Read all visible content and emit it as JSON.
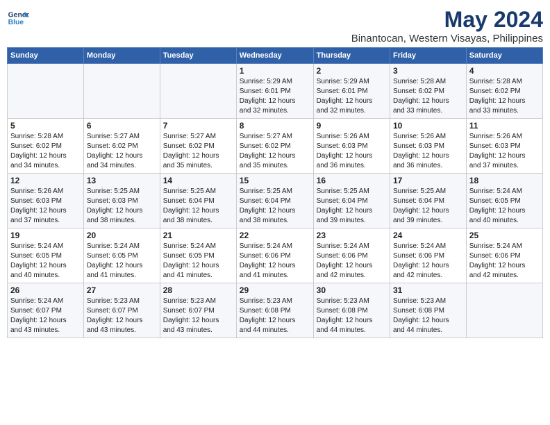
{
  "logo": {
    "line1": "General",
    "line2": "Blue"
  },
  "title": "May 2024",
  "subtitle": "Binantocan, Western Visayas, Philippines",
  "headers": [
    "Sunday",
    "Monday",
    "Tuesday",
    "Wednesday",
    "Thursday",
    "Friday",
    "Saturday"
  ],
  "weeks": [
    [
      {
        "num": "",
        "info": ""
      },
      {
        "num": "",
        "info": ""
      },
      {
        "num": "",
        "info": ""
      },
      {
        "num": "1",
        "info": "Sunrise: 5:29 AM\nSunset: 6:01 PM\nDaylight: 12 hours\nand 32 minutes."
      },
      {
        "num": "2",
        "info": "Sunrise: 5:29 AM\nSunset: 6:01 PM\nDaylight: 12 hours\nand 32 minutes."
      },
      {
        "num": "3",
        "info": "Sunrise: 5:28 AM\nSunset: 6:02 PM\nDaylight: 12 hours\nand 33 minutes."
      },
      {
        "num": "4",
        "info": "Sunrise: 5:28 AM\nSunset: 6:02 PM\nDaylight: 12 hours\nand 33 minutes."
      }
    ],
    [
      {
        "num": "5",
        "info": "Sunrise: 5:28 AM\nSunset: 6:02 PM\nDaylight: 12 hours\nand 34 minutes."
      },
      {
        "num": "6",
        "info": "Sunrise: 5:27 AM\nSunset: 6:02 PM\nDaylight: 12 hours\nand 34 minutes."
      },
      {
        "num": "7",
        "info": "Sunrise: 5:27 AM\nSunset: 6:02 PM\nDaylight: 12 hours\nand 35 minutes."
      },
      {
        "num": "8",
        "info": "Sunrise: 5:27 AM\nSunset: 6:02 PM\nDaylight: 12 hours\nand 35 minutes."
      },
      {
        "num": "9",
        "info": "Sunrise: 5:26 AM\nSunset: 6:03 PM\nDaylight: 12 hours\nand 36 minutes."
      },
      {
        "num": "10",
        "info": "Sunrise: 5:26 AM\nSunset: 6:03 PM\nDaylight: 12 hours\nand 36 minutes."
      },
      {
        "num": "11",
        "info": "Sunrise: 5:26 AM\nSunset: 6:03 PM\nDaylight: 12 hours\nand 37 minutes."
      }
    ],
    [
      {
        "num": "12",
        "info": "Sunrise: 5:26 AM\nSunset: 6:03 PM\nDaylight: 12 hours\nand 37 minutes."
      },
      {
        "num": "13",
        "info": "Sunrise: 5:25 AM\nSunset: 6:03 PM\nDaylight: 12 hours\nand 38 minutes."
      },
      {
        "num": "14",
        "info": "Sunrise: 5:25 AM\nSunset: 6:04 PM\nDaylight: 12 hours\nand 38 minutes."
      },
      {
        "num": "15",
        "info": "Sunrise: 5:25 AM\nSunset: 6:04 PM\nDaylight: 12 hours\nand 38 minutes."
      },
      {
        "num": "16",
        "info": "Sunrise: 5:25 AM\nSunset: 6:04 PM\nDaylight: 12 hours\nand 39 minutes."
      },
      {
        "num": "17",
        "info": "Sunrise: 5:25 AM\nSunset: 6:04 PM\nDaylight: 12 hours\nand 39 minutes."
      },
      {
        "num": "18",
        "info": "Sunrise: 5:24 AM\nSunset: 6:05 PM\nDaylight: 12 hours\nand 40 minutes."
      }
    ],
    [
      {
        "num": "19",
        "info": "Sunrise: 5:24 AM\nSunset: 6:05 PM\nDaylight: 12 hours\nand 40 minutes."
      },
      {
        "num": "20",
        "info": "Sunrise: 5:24 AM\nSunset: 6:05 PM\nDaylight: 12 hours\nand 41 minutes."
      },
      {
        "num": "21",
        "info": "Sunrise: 5:24 AM\nSunset: 6:05 PM\nDaylight: 12 hours\nand 41 minutes."
      },
      {
        "num": "22",
        "info": "Sunrise: 5:24 AM\nSunset: 6:06 PM\nDaylight: 12 hours\nand 41 minutes."
      },
      {
        "num": "23",
        "info": "Sunrise: 5:24 AM\nSunset: 6:06 PM\nDaylight: 12 hours\nand 42 minutes."
      },
      {
        "num": "24",
        "info": "Sunrise: 5:24 AM\nSunset: 6:06 PM\nDaylight: 12 hours\nand 42 minutes."
      },
      {
        "num": "25",
        "info": "Sunrise: 5:24 AM\nSunset: 6:06 PM\nDaylight: 12 hours\nand 42 minutes."
      }
    ],
    [
      {
        "num": "26",
        "info": "Sunrise: 5:24 AM\nSunset: 6:07 PM\nDaylight: 12 hours\nand 43 minutes."
      },
      {
        "num": "27",
        "info": "Sunrise: 5:23 AM\nSunset: 6:07 PM\nDaylight: 12 hours\nand 43 minutes."
      },
      {
        "num": "28",
        "info": "Sunrise: 5:23 AM\nSunset: 6:07 PM\nDaylight: 12 hours\nand 43 minutes."
      },
      {
        "num": "29",
        "info": "Sunrise: 5:23 AM\nSunset: 6:08 PM\nDaylight: 12 hours\nand 44 minutes."
      },
      {
        "num": "30",
        "info": "Sunrise: 5:23 AM\nSunset: 6:08 PM\nDaylight: 12 hours\nand 44 minutes."
      },
      {
        "num": "31",
        "info": "Sunrise: 5:23 AM\nSunset: 6:08 PM\nDaylight: 12 hours\nand 44 minutes."
      },
      {
        "num": "",
        "info": ""
      }
    ]
  ]
}
